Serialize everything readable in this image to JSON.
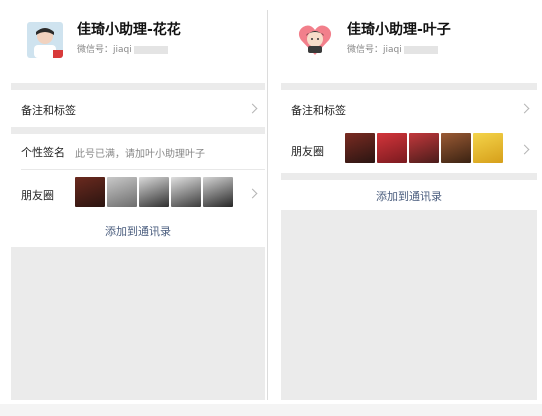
{
  "left_card": {
    "name": "佳琦小助理-花花",
    "wechat_id_label": "微信号：jiaqi",
    "avatar": "avatar-photo-icon",
    "rows": {
      "remark_label": "备注和标签",
      "signature_label": "个性签名",
      "signature_value": "此号已满，请加叶小助理叶子",
      "moments_label": "朋友圈"
    },
    "moments_thumb_colors": [
      "#6b2a1f",
      "#8a8a8a",
      "#3a3a3a",
      "#4d4d4d",
      "#2e2e2e"
    ],
    "add_contact_label": "添加到通讯录"
  },
  "right_card": {
    "name": "佳琦小助理-叶子",
    "wechat_id_label": "微信号：jiaqi",
    "avatar": "heart-cartoon-avatar-icon",
    "rows": {
      "remark_label": "备注和标签",
      "moments_label": "朋友圈"
    },
    "moments_thumb_colors": [
      "#5a1f1a",
      "#b3242b",
      "#9e2a2f",
      "#6a3b23",
      "#e3b92a"
    ],
    "add_contact_label": "添加到通讯录"
  },
  "colors": {
    "link": "#4a5d7e",
    "panel_bg": "#ebebeb"
  }
}
